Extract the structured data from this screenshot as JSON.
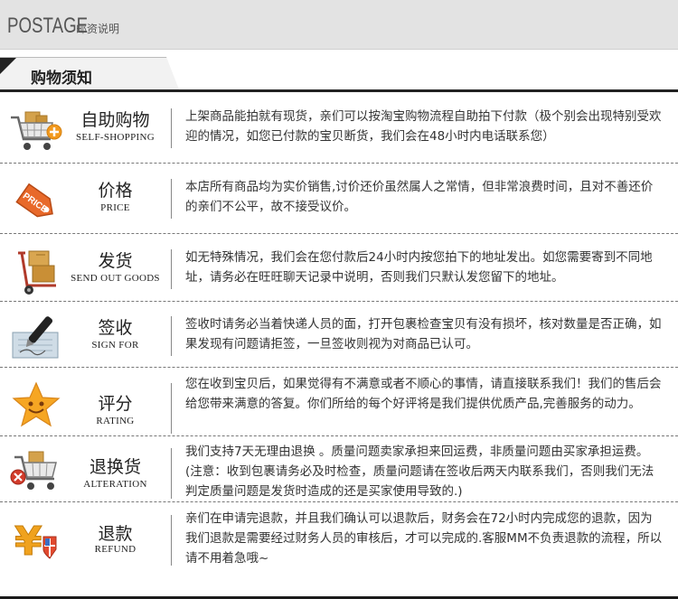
{
  "header": {
    "title": "POSTAGE",
    "subtitle": "邮资说明"
  },
  "section": {
    "title": "购物须知"
  },
  "items": [
    {
      "cn": "自助购物",
      "en": "SELF-SHOPPING",
      "icon": "shopping-cart-icon",
      "desc": "上架商品能拍就有现货，亲们可以按淘宝购物流程自助拍下付款（极个别会出现特别受欢迎的情况，如您已付款的宝贝断货，我们会在48小时内电话联系您）"
    },
    {
      "cn": "价格",
      "en": "PRICE",
      "icon": "price-tag-icon",
      "price_tag_text": "PRICE",
      "desc": "本店所有商品均为实价销售,讨价还价虽然属人之常情，但非常浪费时间，且对不善还价的亲们不公平，故不接受议价。"
    },
    {
      "cn": "发货",
      "en": "SEND OUT GOODS",
      "icon": "hand-truck-icon",
      "desc": "如无特殊情况，我们会在您付款后24小时内按您拍下的地址发出。如您需要寄到不同地址，请务必在旺旺聊天记录中说明，否则我们只默认发您留下的地址。"
    },
    {
      "cn": "签收",
      "en": "SIGN FOR",
      "icon": "pen-sign-icon",
      "desc": "签收时请务必当着快递人员的面，打开包裹检查宝贝有没有损坏，核对数量是否正确，如果发现有问题请拒签，一旦签收则视为对商品已认可。"
    },
    {
      "cn": "评分",
      "en": "RATING",
      "icon": "smiling-star-icon",
      "desc": "您在收到宝贝后，如果觉得有不满意或者不顺心的事情，请直接联系我们！我们的售后会给您带来满意的答复。你们所给的每个好评将是我们提供优质产品,完善服务的动力。"
    },
    {
      "cn": "退换货",
      "en": "ALTERATION",
      "icon": "cart-remove-icon",
      "desc": "我们支持7天无理由退换 。质量问题卖家承担来回运费，非质量问题由买家承担运费。(注意：收到包裹请务必及时检查，质量问题请在签收后两天内联系我们，否则我们无法判定质量问题是发货时造成的还是买家使用导致的.)"
    },
    {
      "cn": "退款",
      "en": "REFUND",
      "icon": "yen-refund-icon",
      "desc": "亲们在申请完退款，并且我们确认可以退款后，财务会在72小时内完成您的退款，因为我们退款是需要经过财务人员的审核后，才可以完成的.客服MM不负责退款的流程，所以请不用着急哦~"
    }
  ]
}
